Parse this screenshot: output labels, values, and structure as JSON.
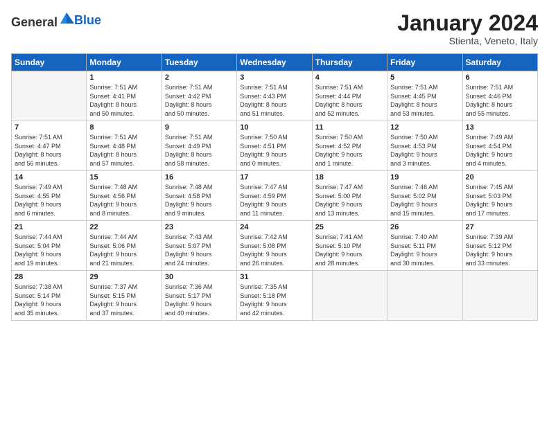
{
  "header": {
    "logo_general": "General",
    "logo_blue": "Blue",
    "title": "January 2024",
    "subtitle": "Stienta, Veneto, Italy"
  },
  "days_of_week": [
    "Sunday",
    "Monday",
    "Tuesday",
    "Wednesday",
    "Thursday",
    "Friday",
    "Saturday"
  ],
  "weeks": [
    [
      {
        "day": "",
        "info": ""
      },
      {
        "day": "1",
        "info": "Sunrise: 7:51 AM\nSunset: 4:41 PM\nDaylight: 8 hours\nand 50 minutes."
      },
      {
        "day": "2",
        "info": "Sunrise: 7:51 AM\nSunset: 4:42 PM\nDaylight: 8 hours\nand 50 minutes."
      },
      {
        "day": "3",
        "info": "Sunrise: 7:51 AM\nSunset: 4:43 PM\nDaylight: 8 hours\nand 51 minutes."
      },
      {
        "day": "4",
        "info": "Sunrise: 7:51 AM\nSunset: 4:44 PM\nDaylight: 8 hours\nand 52 minutes."
      },
      {
        "day": "5",
        "info": "Sunrise: 7:51 AM\nSunset: 4:45 PM\nDaylight: 8 hours\nand 53 minutes."
      },
      {
        "day": "6",
        "info": "Sunrise: 7:51 AM\nSunset: 4:46 PM\nDaylight: 8 hours\nand 55 minutes."
      }
    ],
    [
      {
        "day": "7",
        "info": "Sunrise: 7:51 AM\nSunset: 4:47 PM\nDaylight: 8 hours\nand 56 minutes."
      },
      {
        "day": "8",
        "info": "Sunrise: 7:51 AM\nSunset: 4:48 PM\nDaylight: 8 hours\nand 57 minutes."
      },
      {
        "day": "9",
        "info": "Sunrise: 7:51 AM\nSunset: 4:49 PM\nDaylight: 8 hours\nand 58 minutes."
      },
      {
        "day": "10",
        "info": "Sunrise: 7:50 AM\nSunset: 4:51 PM\nDaylight: 9 hours\nand 0 minutes."
      },
      {
        "day": "11",
        "info": "Sunrise: 7:50 AM\nSunset: 4:52 PM\nDaylight: 9 hours\nand 1 minute."
      },
      {
        "day": "12",
        "info": "Sunrise: 7:50 AM\nSunset: 4:53 PM\nDaylight: 9 hours\nand 3 minutes."
      },
      {
        "day": "13",
        "info": "Sunrise: 7:49 AM\nSunset: 4:54 PM\nDaylight: 9 hours\nand 4 minutes."
      }
    ],
    [
      {
        "day": "14",
        "info": "Sunrise: 7:49 AM\nSunset: 4:55 PM\nDaylight: 9 hours\nand 6 minutes."
      },
      {
        "day": "15",
        "info": "Sunrise: 7:48 AM\nSunset: 4:56 PM\nDaylight: 9 hours\nand 8 minutes."
      },
      {
        "day": "16",
        "info": "Sunrise: 7:48 AM\nSunset: 4:58 PM\nDaylight: 9 hours\nand 9 minutes."
      },
      {
        "day": "17",
        "info": "Sunrise: 7:47 AM\nSunset: 4:59 PM\nDaylight: 9 hours\nand 11 minutes."
      },
      {
        "day": "18",
        "info": "Sunrise: 7:47 AM\nSunset: 5:00 PM\nDaylight: 9 hours\nand 13 minutes."
      },
      {
        "day": "19",
        "info": "Sunrise: 7:46 AM\nSunset: 5:02 PM\nDaylight: 9 hours\nand 15 minutes."
      },
      {
        "day": "20",
        "info": "Sunrise: 7:45 AM\nSunset: 5:03 PM\nDaylight: 9 hours\nand 17 minutes."
      }
    ],
    [
      {
        "day": "21",
        "info": "Sunrise: 7:44 AM\nSunset: 5:04 PM\nDaylight: 9 hours\nand 19 minutes."
      },
      {
        "day": "22",
        "info": "Sunrise: 7:44 AM\nSunset: 5:06 PM\nDaylight: 9 hours\nand 21 minutes."
      },
      {
        "day": "23",
        "info": "Sunrise: 7:43 AM\nSunset: 5:07 PM\nDaylight: 9 hours\nand 24 minutes."
      },
      {
        "day": "24",
        "info": "Sunrise: 7:42 AM\nSunset: 5:08 PM\nDaylight: 9 hours\nand 26 minutes."
      },
      {
        "day": "25",
        "info": "Sunrise: 7:41 AM\nSunset: 5:10 PM\nDaylight: 9 hours\nand 28 minutes."
      },
      {
        "day": "26",
        "info": "Sunrise: 7:40 AM\nSunset: 5:11 PM\nDaylight: 9 hours\nand 30 minutes."
      },
      {
        "day": "27",
        "info": "Sunrise: 7:39 AM\nSunset: 5:12 PM\nDaylight: 9 hours\nand 33 minutes."
      }
    ],
    [
      {
        "day": "28",
        "info": "Sunrise: 7:38 AM\nSunset: 5:14 PM\nDaylight: 9 hours\nand 35 minutes."
      },
      {
        "day": "29",
        "info": "Sunrise: 7:37 AM\nSunset: 5:15 PM\nDaylight: 9 hours\nand 37 minutes."
      },
      {
        "day": "30",
        "info": "Sunrise: 7:36 AM\nSunset: 5:17 PM\nDaylight: 9 hours\nand 40 minutes."
      },
      {
        "day": "31",
        "info": "Sunrise: 7:35 AM\nSunset: 5:18 PM\nDaylight: 9 hours\nand 42 minutes."
      },
      {
        "day": "",
        "info": ""
      },
      {
        "day": "",
        "info": ""
      },
      {
        "day": "",
        "info": ""
      }
    ]
  ]
}
